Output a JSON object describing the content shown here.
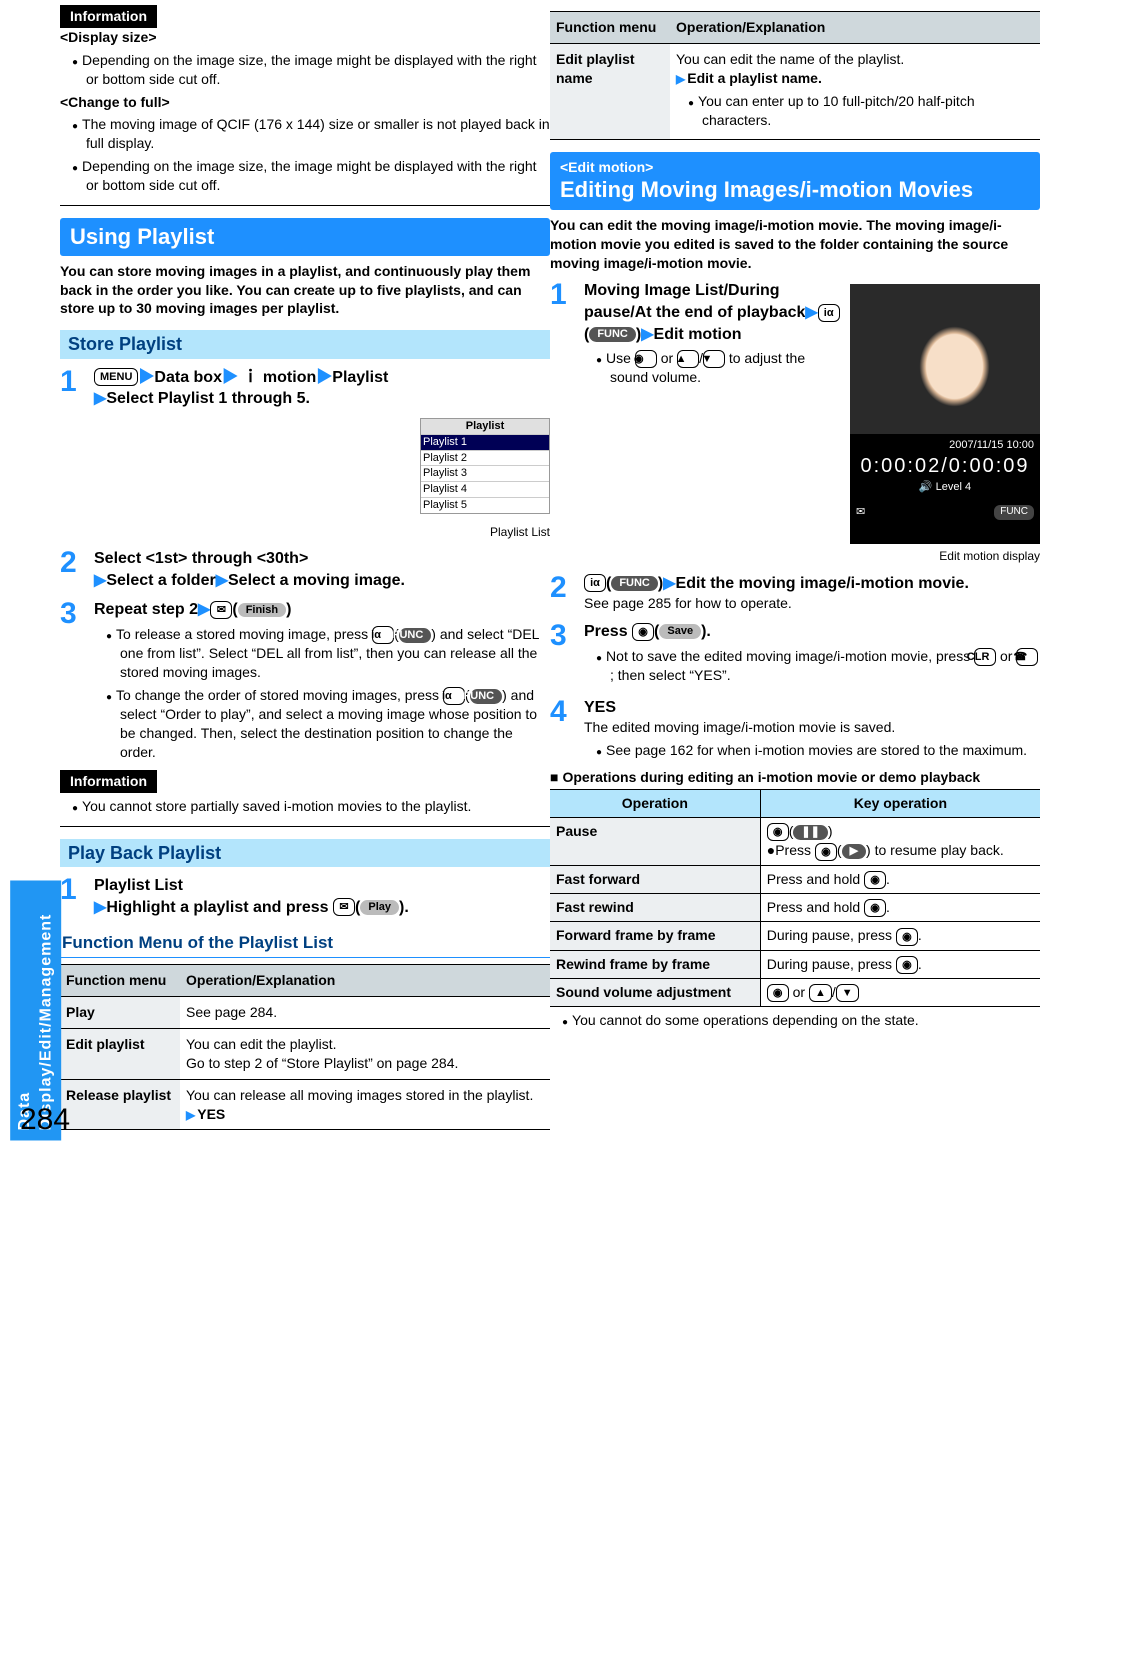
{
  "sidebar": "Data Display/Edit/Management",
  "pagenum": "284",
  "info": {
    "tag": "Information",
    "h1": "<Display size>",
    "b1": "Depending on the image size, the image might be displayed with the right or bottom side cut off.",
    "h2": "<Change to full>",
    "b2": "The moving image of QCIF (176 x 144) size or smaller is not played back in full display.",
    "b3": "Depending on the image size, the image might be displayed with the right or bottom side cut off."
  },
  "upl": {
    "title": "Using Playlist",
    "intro": "You can store moving images in a playlist, and continuously play them back in the order you like. You can create up to five playlists, and can store up to 30 moving images per playlist."
  },
  "store": {
    "h": "Store Playlist",
    "s1a": "Data box",
    "s1b": "motion",
    "s1c": "Playlist",
    "s1d": "Select Playlist 1 through 5.",
    "s2a": "Select <1st> through <30th>",
    "s2b": "Select a folder",
    "s2c": "Select a moving image.",
    "s3h": "Repeat step 2",
    "s3b1": "To release a stored moving image, press ",
    "s3b1b": " and select “DEL one from list”. Select “DEL all from list”, then you can release all the stored moving images.",
    "s3b2a": "To change the order of stored moving images, press ",
    "s3b2b": " and select “Order to play”, and select a moving image whose position to be changed. Then, select the destination position to change the order.",
    "info2": "You cannot store partially saved i-motion movies to the playlist."
  },
  "pbp": {
    "h": "Play Back Playlist",
    "s1a": "Playlist List",
    "s1b": "Highlight a playlist and press "
  },
  "fmenu": {
    "title": "Function Menu of the Playlist List",
    "head1": "Function menu",
    "head2": "Operation/Explanation",
    "rows": [
      {
        "k": "Play",
        "v": "See page 284."
      },
      {
        "k": "Edit playlist",
        "v": "You can edit the playlist.",
        "v2": "Go to step 2 of “Store Playlist” on page 284."
      },
      {
        "k": "Release playlist",
        "v": "You can release all moving images stored in the playlist.",
        "yes": "YES"
      }
    ],
    "rows2": [
      {
        "k": "Edit playlist name",
        "v": "You can edit the name of the playlist.",
        "act": "Edit a playlist name.",
        "note": "You can enter up to 10 full-pitch/20 half-pitch characters."
      }
    ]
  },
  "keys": {
    "menu": "MENU",
    "func": "FUNC",
    "finish": "Finish",
    "play": "Play",
    "save": "Save",
    "clr": "CLR",
    "oo": "◉",
    "mail": "✉",
    "ir": "iα",
    "left": "◀",
    "right": "▶",
    "up": "▲",
    "down": "▼",
    "pause": "❚❚",
    "end": "☎"
  },
  "edit": {
    "tag": "<Edit    motion>",
    "title": "Editing Moving Images/i-motion Movies",
    "intro": "You can edit the moving image/i-motion movie. The moving image/i-motion movie you edited is saved to the folder containing the source moving image/i-motion movie.",
    "s1a": "Moving Image List/During pause/At the end of playback",
    "s1b": "Edit    motion",
    "s1note": "Use ",
    "s1note2": " to adjust the sound volume.",
    "photocap": "Edit    motion display",
    "s2a": "Edit the moving image/i-motion movie.",
    "s2note": "See page 285 for how to operate.",
    "s3a": "Press ",
    "s3note": "Not to save the edited moving image/i-motion movie, press ",
    "s3note2": "; then select “YES”.",
    "s4h": "YES",
    "s4a": "The edited moving image/i-motion movie is saved.",
    "s4b": "See page 162 for when i-motion movies are stored to the maximum.",
    "opsTitle": "Operations during editing an i-motion movie or demo playback",
    "opsH1": "Operation",
    "opsH2": "Key operation",
    "ops": [
      {
        "k": "Pause",
        "v1": "Press ",
        "v2": " to resume play back."
      },
      {
        "k": "Fast forward",
        "v": "Press and hold "
      },
      {
        "k": "Fast rewind",
        "v": "Press and hold "
      },
      {
        "k": "Forward frame by frame",
        "v": "During pause, press "
      },
      {
        "k": "Rewind frame by frame",
        "v": "During pause, press "
      },
      {
        "k": "Sound volume adjustment"
      }
    ],
    "tail": "You cannot do some operations depending on the state."
  },
  "shots": {
    "playlistCap": "Playlist List",
    "p": {
      "h": "Playlist",
      "r": [
        "Playlist 1",
        "Playlist 2",
        "Playlist 3",
        "Playlist 4",
        "Playlist 5"
      ]
    },
    "photo": {
      "date": "2007/11/15 10:00",
      "t": "0:00:02/0:00:09",
      "lv": "Level  4",
      "func": "FUNC"
    }
  }
}
